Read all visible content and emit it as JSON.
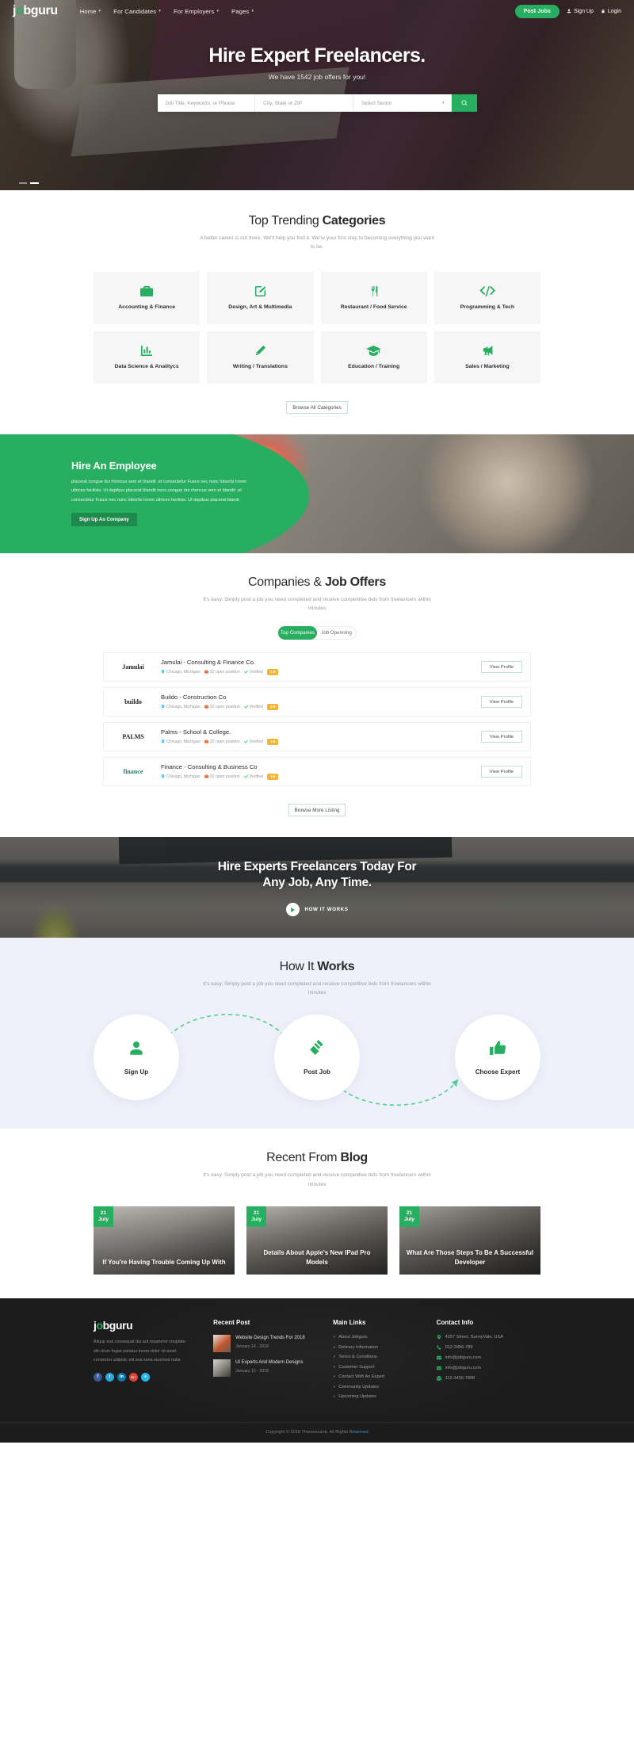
{
  "header": {
    "logo": {
      "pre": "j",
      "leaf": "o",
      "post": "bguru"
    },
    "nav": [
      {
        "label": "Home",
        "caret": "▾"
      },
      {
        "label": "For Candidates",
        "caret": "▾"
      },
      {
        "label": "For Employers",
        "caret": "▾"
      },
      {
        "label": "Pages",
        "caret": "▾"
      }
    ],
    "post_jobs": "Post Jobs",
    "sign_up": "Sign Up",
    "login": "Login"
  },
  "hero": {
    "title": "Hire Expert Freelancers.",
    "subtitle": "We have 1542 job offers for you!",
    "search": {
      "keyword_placeholder": "Job Title, Keywords, or Phrase",
      "location_placeholder": "City, State or ZIP",
      "sector_placeholder": "Select Sector",
      "sector_caret": "▾"
    }
  },
  "categories": {
    "title_light": "Top Trending ",
    "title_bold": "Categories",
    "desc": "A better career is out there. We'll help you find it. We're your first step to becoming everything you want to be.",
    "items": [
      {
        "label": "Accounting & Finance",
        "icon": "briefcase-icon"
      },
      {
        "label": "Design, Art & Multimedia",
        "icon": "pencil-square-icon"
      },
      {
        "label": "Restaurant / Food Service",
        "icon": "fork-knife-icon"
      },
      {
        "label": "Programming & Tech",
        "icon": "code-icon"
      },
      {
        "label": "Data Science & Analitycs",
        "icon": "bar-chart-icon"
      },
      {
        "label": "Writing / Translations",
        "icon": "pencil-icon"
      },
      {
        "label": "Education / Training",
        "icon": "graduation-cap-icon"
      },
      {
        "label": "Sales / Marketing",
        "icon": "megaphone-icon"
      }
    ],
    "browse_all": "Browse All Categories"
  },
  "hire": {
    "title": "Hire An Employee",
    "text": "placerat congue dui rhoncus sem et blandit .et consectetur Fusce nec nunc lobortis lorem ultrices facilisis. Ut dapibus placerat blandit nunc.congue dui rhoncus sem et blandit .et consectetur Fusce nec nunc lobortis lorem ultrices facilisis. Ut dapibus placerat blandi",
    "button": "Sign Up As Company"
  },
  "companies": {
    "title_light": "Companies & ",
    "title_bold": "Job Offers",
    "desc": "It's easy. Simply post a job you need completed and receive competitive bids from freelancers within minutes",
    "tabs": [
      {
        "label": "Top Companies",
        "active": true
      },
      {
        "label": "Job Openning",
        "active": false
      }
    ],
    "rows": [
      {
        "logo": "Jamulai",
        "name": "Jamulai - Consulting & Finance Co.",
        "location": "Chicago, Michigan",
        "positions": "32 open position",
        "verified": "Verified",
        "rating": "4.9",
        "action": "View Profile"
      },
      {
        "logo": "buildo",
        "name": "Buildo - Construction Co",
        "location": "Chicago, Michigan",
        "positions": "32 open position",
        "verified": "Verified",
        "rating": "4.9",
        "action": "View Profile"
      },
      {
        "logo": "PALMS",
        "name": "Palms - School & College.",
        "location": "Chicago, Michigan",
        "positions": "32 open position",
        "verified": "Verified",
        "rating": "4.6",
        "action": "View Profile"
      },
      {
        "logo": "finance",
        "name": "Finance - Consulting & Business Co",
        "location": "Chicago, Michigan",
        "positions": "32 open position",
        "verified": "Verified",
        "rating": "4.9",
        "action": "View Profile"
      }
    ],
    "browse_more": "Browse More Listing"
  },
  "video_cta": {
    "line1": "Hire Experts Freelancers Today For",
    "line2": "Any Job, Any Time.",
    "play_label": "HOW IT WORKS"
  },
  "how_it_works": {
    "title_light": "How It ",
    "title_bold": "Works",
    "desc": "It's easy. Simply post a job you need completed and receive competitive bids from freelancers within minutes",
    "steps": [
      {
        "label": "Sign Up",
        "icon": "user-icon"
      },
      {
        "label": "Post Job",
        "icon": "gavel-icon"
      },
      {
        "label": "Choose Expert",
        "icon": "thumbs-up-icon"
      }
    ]
  },
  "blog": {
    "title_light": "Recent From ",
    "title_bold": "Blog",
    "desc": "It's easy. Simply post a job you need completed and receive competitive bids from freelancers within minutes",
    "posts": [
      {
        "day": "21",
        "month": "July",
        "title": "If You're Having Trouble Coming Up With"
      },
      {
        "day": "21",
        "month": "July",
        "title": "Details About Apple's New IPad Pro Models"
      },
      {
        "day": "21",
        "month": "July",
        "title": "What Are Those Steps To Be A Successful Developer"
      }
    ]
  },
  "footer": {
    "logo": {
      "pre": "j",
      "leaf": "o",
      "post": "bguru"
    },
    "about": "Aliqup exa consequat dui aut repahend vouptate elit cilum fugiat pariatur lorem dolor cit amet consecter adipisic elit sea vena eiusmod nulla",
    "socials": [
      {
        "name": "facebook-icon",
        "glyph": "f"
      },
      {
        "name": "twitter-icon",
        "glyph": "t"
      },
      {
        "name": "linkedin-icon",
        "glyph": "in"
      },
      {
        "name": "google-plus-icon",
        "glyph": "G+"
      },
      {
        "name": "skype-icon",
        "glyph": "s"
      }
    ],
    "recent_post_heading": "Recent Post",
    "recent_posts": [
      {
        "title": "Website Design Trends For 2018",
        "date": "January 14 - 2018"
      },
      {
        "title": "UI Experts And Modern Designs",
        "date": "January 12 - 2018"
      }
    ],
    "main_links_heading": "Main Links",
    "main_links": [
      "About Jobguru",
      "Delivery Information",
      "Terms & Conditions",
      "Customer Support",
      "Contact With An Expert",
      "Community Updates",
      "Upcoming Updates"
    ],
    "link_arrow": "»",
    "contact_heading": "Contact Info",
    "contact": [
      {
        "icon": "map-pin-icon",
        "text": "4257 Street, SunnyVale, USA"
      },
      {
        "icon": "phone-icon",
        "text": "012-3456-789"
      },
      {
        "icon": "envelope-icon",
        "text": "info@jobguru.com"
      },
      {
        "icon": "envelope-icon",
        "text": "info@jobguru.com"
      },
      {
        "icon": "fax-icon",
        "text": "112-3456-7898"
      }
    ],
    "copyright_pre": "Copyright © 2018 Themesxanb, All Rights ",
    "copyright_link": "Reserved"
  },
  "colors": {
    "accent": "#27ae60",
    "badge": "#f5b335",
    "footer_bg": "#1c1c1c",
    "howitworks_bg": "#eef1fa"
  }
}
